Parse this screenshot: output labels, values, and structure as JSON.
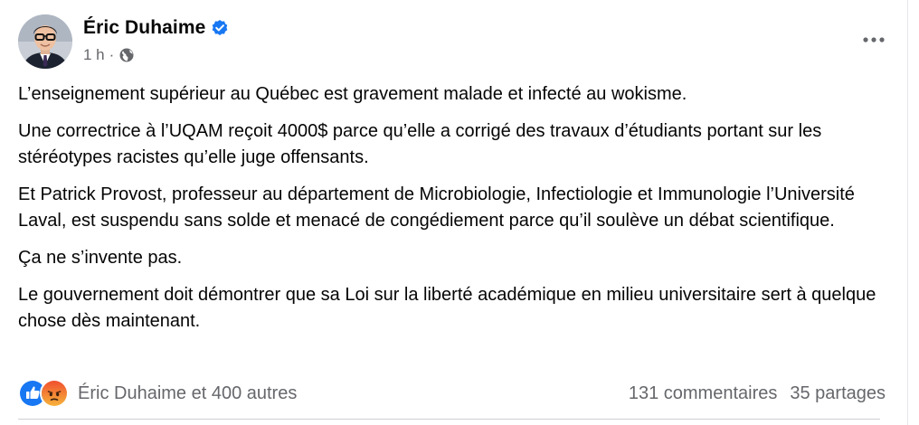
{
  "post": {
    "author": "Éric Duhaime",
    "time": "1 h",
    "separator": "·",
    "icons": {
      "verified": "verified-badge-icon",
      "audience": "globe-icon",
      "more": "more-options-icon"
    },
    "paragraphs": [
      "L’enseignement supérieur au Québec est gravement malade et infecté au wokisme.",
      "Une correctrice à l’UQAM reçoit 4000$ parce qu’elle a corrigé des travaux d’étudiants portant sur les stéréotypes racistes qu’elle juge offensants.",
      "Et Patrick Provost, professeur au département de Microbiologie, Infectiologie et Immunologie l’Université Laval, est suspendu sans solde et menacé de congédiement parce qu’il soulève un débat scientifique.",
      "Ça ne s’invente pas.",
      "Le gouvernement doit démontrer que sa Loi sur la liberté académique en milieu universitaire sert à quelque chose dès maintenant."
    ],
    "footer": {
      "reactions": [
        "like-reaction-icon",
        "angry-reaction-icon"
      ],
      "reactors_text": "Éric Duhaime et 400 autres",
      "comments": "131 commentaires",
      "shares": "35 partages"
    },
    "colors": {
      "verified": "#1877f2",
      "like": "#1877f2",
      "angry_top": "#f5a623",
      "angry_bottom": "#e9710f",
      "secondary_text": "#65676b"
    }
  }
}
